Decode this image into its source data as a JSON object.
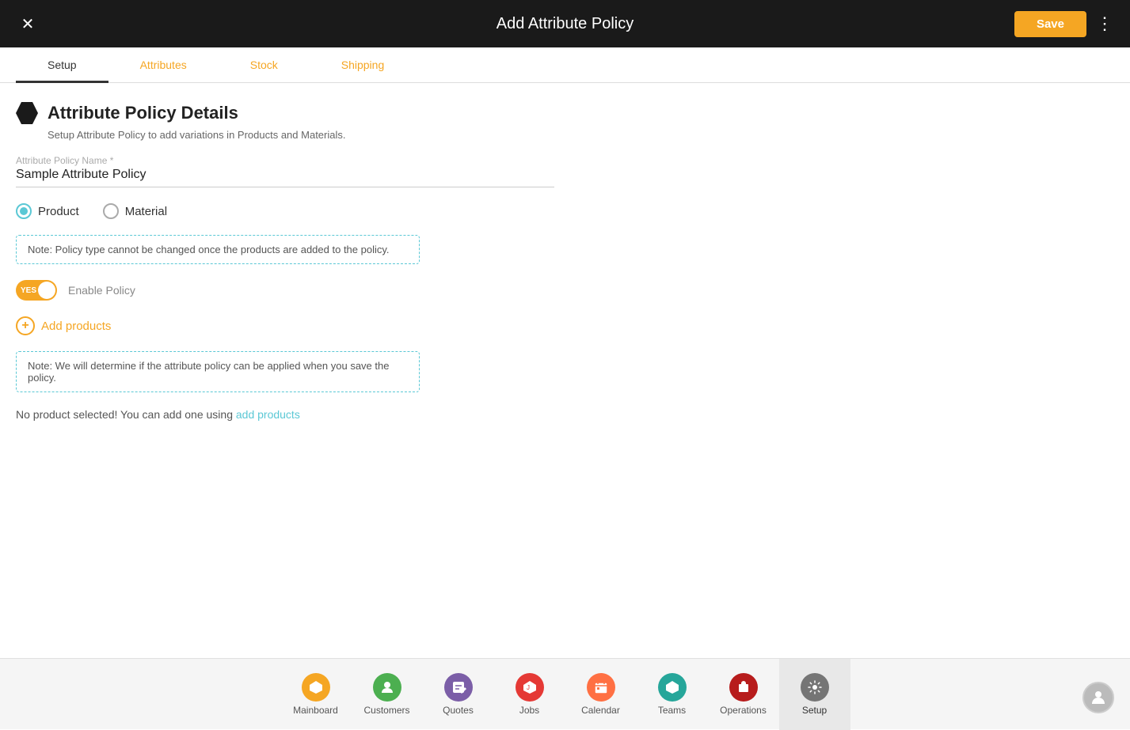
{
  "header": {
    "close_icon": "✕",
    "title": "Add Attribute Policy",
    "save_label": "Save",
    "more_icon": "⋮"
  },
  "tabs": [
    {
      "id": "setup",
      "label": "Setup",
      "active": true,
      "colored": false
    },
    {
      "id": "attributes",
      "label": "Attributes",
      "active": false,
      "colored": true
    },
    {
      "id": "stock",
      "label": "Stock",
      "active": false,
      "colored": true
    },
    {
      "id": "shipping",
      "label": "Shipping",
      "active": false,
      "colored": true
    }
  ],
  "form": {
    "section_title": "Attribute Policy Details",
    "section_subtitle": "Setup Attribute Policy to add variations in Products and Materials.",
    "field_label": "Attribute Policy Name *",
    "field_value": "Sample Attribute Policy",
    "radio_product_label": "Product",
    "radio_material_label": "Material",
    "note_policy_type": "Note: Policy type cannot be changed once the products are added to the policy.",
    "toggle_label": "YES",
    "enable_policy_label": "Enable Policy",
    "add_products_label": "Add products",
    "note_save": "Note: We will determine if the attribute policy can be applied when you save the policy.",
    "no_product_msg_prefix": "No product selected! You can add one using ",
    "no_product_link": "add products"
  },
  "bottom_nav": {
    "items": [
      {
        "id": "mainboard",
        "label": "Mainboard",
        "icon": "⬡",
        "color": "yellow"
      },
      {
        "id": "customers",
        "label": "Customers",
        "icon": "👤",
        "color": "green"
      },
      {
        "id": "quotes",
        "label": "Quotes",
        "icon": "🗨",
        "color": "purple"
      },
      {
        "id": "jobs",
        "label": "Jobs",
        "icon": "🗂",
        "color": "red"
      },
      {
        "id": "calendar",
        "label": "Calendar",
        "icon": "📅",
        "color": "orange2"
      },
      {
        "id": "teams",
        "label": "Teams",
        "icon": "⬡",
        "color": "teal"
      },
      {
        "id": "operations",
        "label": "Operations",
        "icon": "💼",
        "color": "darkred"
      },
      {
        "id": "setup",
        "label": "Setup",
        "icon": "⚙",
        "color": "gray",
        "active": true
      }
    ]
  }
}
